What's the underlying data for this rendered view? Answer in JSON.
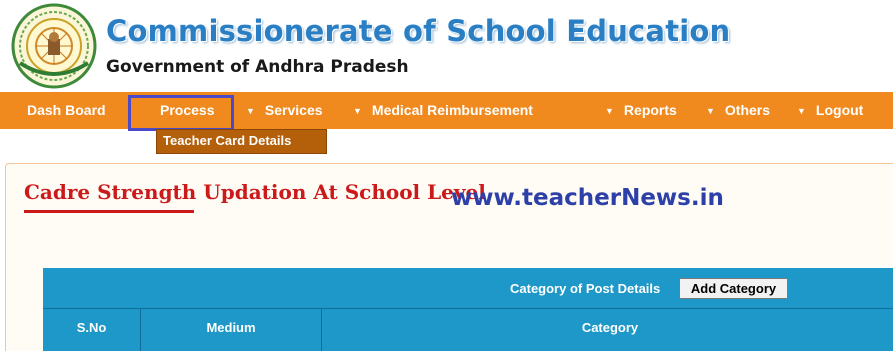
{
  "header": {
    "title": "Commissionerate of School Education",
    "subtitle": "Government of Andhra Pradesh"
  },
  "nav": {
    "items": [
      {
        "label": "Dash Board",
        "has_dropdown": false
      },
      {
        "label": "Process",
        "has_dropdown": false
      },
      {
        "label": "Services",
        "has_dropdown": true
      },
      {
        "label": "Medical Reimbursement",
        "has_dropdown": true
      },
      {
        "label": "Reports",
        "has_dropdown": true
      },
      {
        "label": "Others",
        "has_dropdown": true
      },
      {
        "label": "Logout",
        "has_dropdown": true
      }
    ],
    "open_menu_item": "Teacher Card Details",
    "dropdown_glyph": "▼"
  },
  "content": {
    "heading": "Cadre Strength Updation At School Level",
    "watermark": "www.teacherNews.in"
  },
  "table": {
    "caption": "Category of Post Details",
    "add_button": "Add Category",
    "columns": [
      "S.No",
      "Medium",
      "Category"
    ]
  },
  "colors": {
    "nav_bg": "#f08a1e",
    "dropdown_bg": "#b45f0a",
    "title_blue": "#2a7fc4",
    "heading_red": "#cc1a1a",
    "table_header": "#1e98c8",
    "highlight_box": "#4a4ac8"
  }
}
